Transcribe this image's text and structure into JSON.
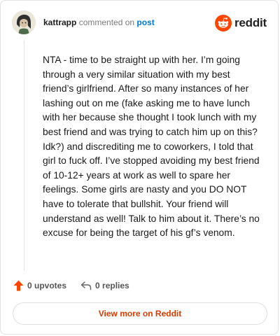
{
  "header": {
    "username": "kattrapp",
    "action_text": "commented on",
    "post_link": "post",
    "brand": "reddit"
  },
  "comment": {
    "body": "NTA - time to be straight up with her. I’m going through a very similar situation with my best friend’s girlfriend. After so many instances of her lashing out on me (fake asking me to have lunch with her because she thought I took lunch with my best friend and was trying to catch him up on this? Idk?) and discrediting me to coworkers, I told that girl to fuck off. I’ve stopped avoiding my best friend of 10-12+ years at work as well to spare her feelings. Some girls are nasty and you DO NOT have to tolerate that bullshit. Your friend will understand as well! Talk to him about it. There’s no excuse for being the target of his gf’s venom."
  },
  "actions": {
    "upvotes_label": "0 upvotes",
    "replies_label": "0 replies"
  },
  "footer": {
    "view_more_label": "View more on Reddit"
  },
  "colors": {
    "brand_orange": "#ff4500",
    "link_blue": "#0079d3",
    "cta_red": "#d93a00"
  },
  "icons": [
    "avatar-image",
    "reddit-logo-icon",
    "upvote-arrow-icon",
    "reply-icon"
  ]
}
